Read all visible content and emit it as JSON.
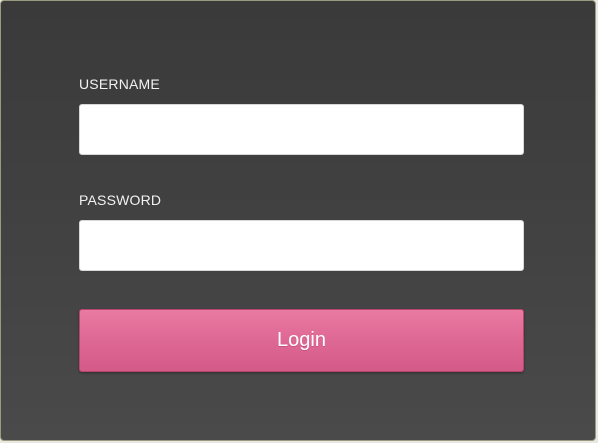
{
  "login_form": {
    "username_label": "USERNAME",
    "username_value": "",
    "password_label": "PASSWORD",
    "password_value": "",
    "submit_label": "Login"
  },
  "colors": {
    "panel_background": "#3d3d3d",
    "label_text": "#f2f2f2",
    "input_background": "#ffffff",
    "button_pink": "#de6894",
    "button_text": "#ffffff"
  }
}
